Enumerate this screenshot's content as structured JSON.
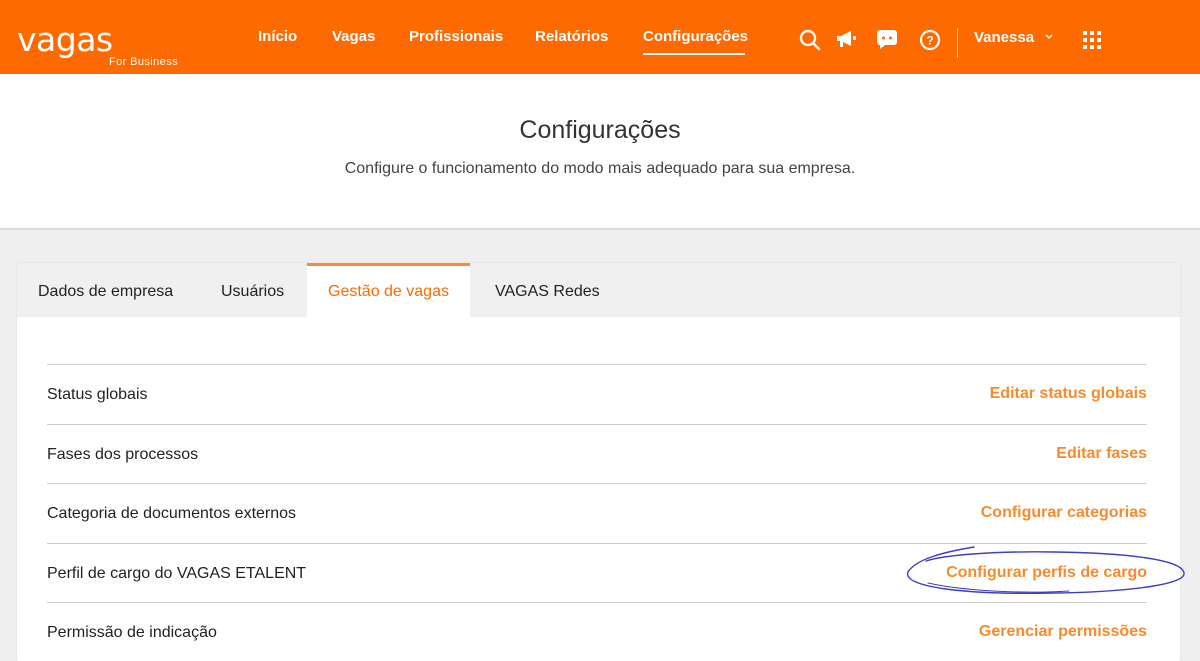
{
  "brand": {
    "logo_word": "vagas",
    "logo_sub": "For Business"
  },
  "nav": {
    "items": [
      {
        "label": "Início"
      },
      {
        "label": "Vagas"
      },
      {
        "label": "Profissionais"
      },
      {
        "label": "Relatórios"
      },
      {
        "label": "Configurações",
        "active": true
      }
    ]
  },
  "toolbar_icons": [
    "search-icon",
    "megaphone-icon",
    "chat-icon",
    "help-icon"
  ],
  "user": {
    "name": "Vanessa"
  },
  "header": {
    "title": "Configurações",
    "subtitle": "Configure o funcionamento do modo mais adequado para sua empresa."
  },
  "tabs": [
    {
      "label": "Dados de empresa"
    },
    {
      "label": "Usuários"
    },
    {
      "label": "Gestão de vagas",
      "active": true
    },
    {
      "label": "VAGAS Redes"
    }
  ],
  "settings_rows": [
    {
      "label": "Status globais",
      "action": "Editar status globais"
    },
    {
      "label": "Fases dos processos",
      "action": "Editar fases"
    },
    {
      "label": "Categoria de documentos externos",
      "action": "Configurar categorias"
    },
    {
      "label": "Perfil de cargo do VAGAS ETALENT",
      "action": "Configurar perfis de cargo",
      "highlighted": true
    },
    {
      "label": "Permissão de indicação",
      "action": "Gerenciar permissões"
    }
  ],
  "colors": {
    "brand_orange": "#ff6a00",
    "link_orange": "#f68b2d",
    "highlight_ink": "#3f3fbf"
  }
}
